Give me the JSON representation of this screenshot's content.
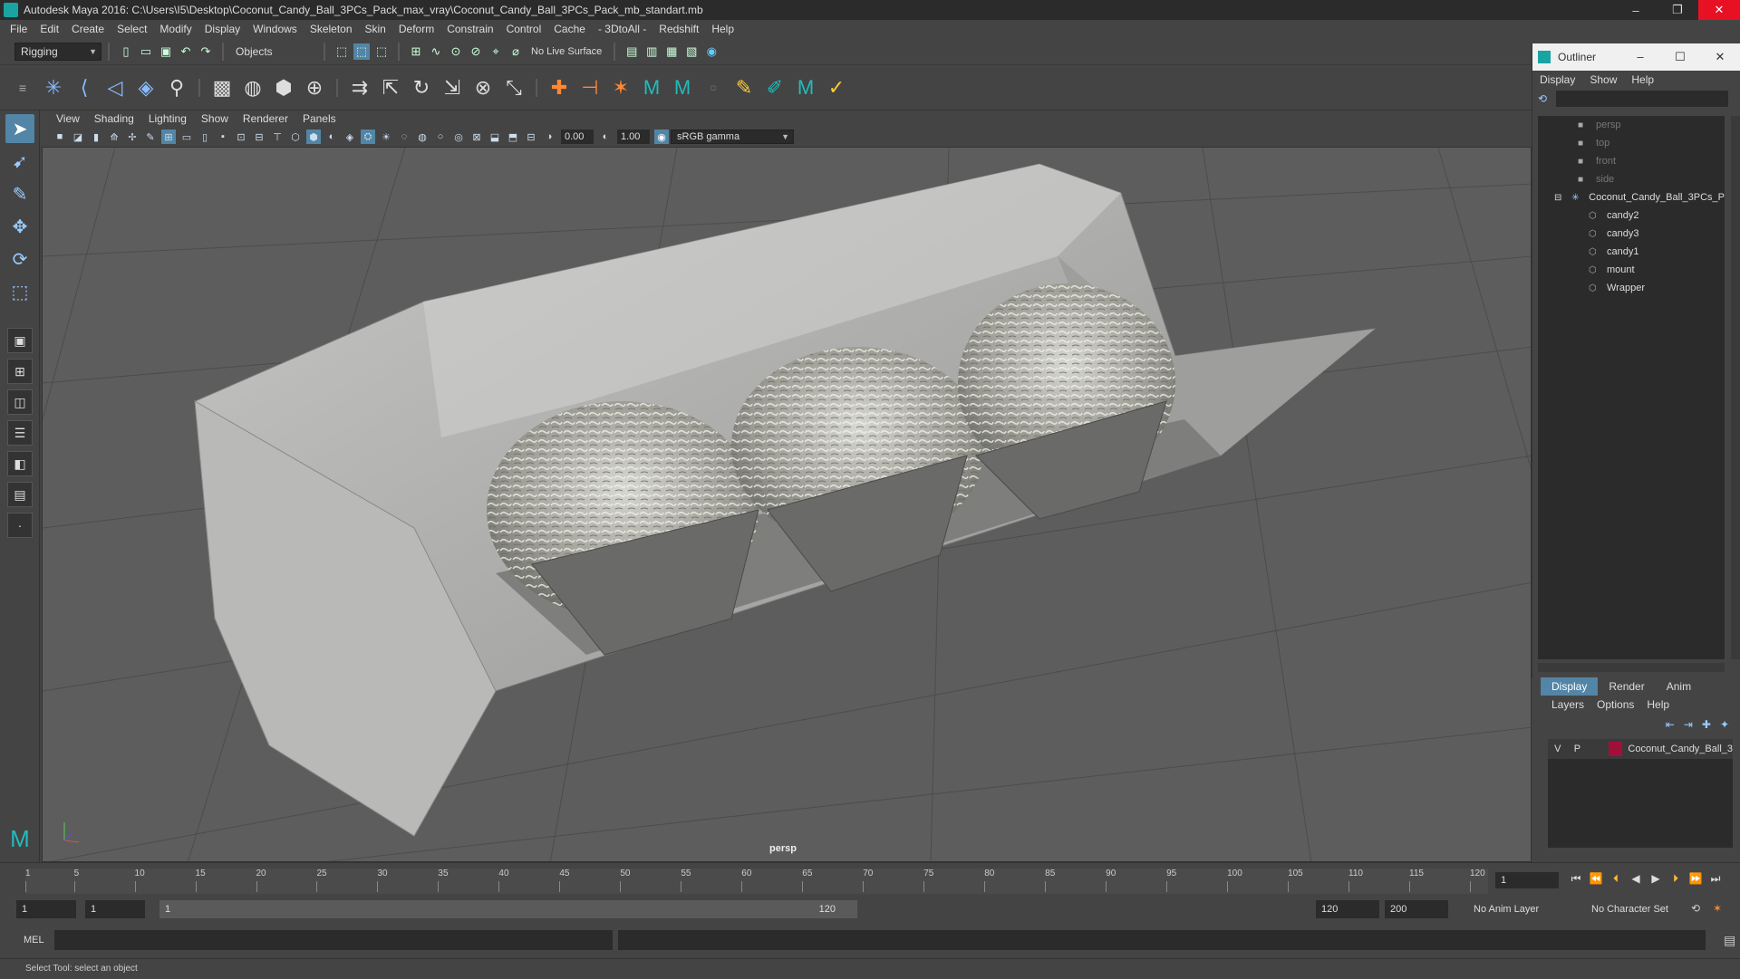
{
  "window": {
    "title": "Autodesk Maya 2016: C:\\Users\\I5\\Desktop\\Coconut_Candy_Ball_3PCs_Pack_max_vray\\Coconut_Candy_Ball_3PCs_Pack_mb_standart.mb",
    "minimize": "–",
    "restore": "❐",
    "close": "✕"
  },
  "menus": [
    "File",
    "Edit",
    "Create",
    "Select",
    "Modify",
    "Display",
    "Windows",
    "Skeleton",
    "Skin",
    "Deform",
    "Constrain",
    "Control",
    "Cache",
    "- 3DtoAll -",
    "Redshift",
    "Help"
  ],
  "status_line": {
    "menuset": "Rigging",
    "select_mode": "Objects",
    "live_surface": "No Live Surface"
  },
  "panel": {
    "menus": [
      "View",
      "Shading",
      "Lighting",
      "Show",
      "Renderer",
      "Panels"
    ],
    "exposure": "0.00",
    "gamma": "1.00",
    "color_space": "sRGB gamma",
    "camera_label": "persp"
  },
  "outliner": {
    "title": "Outliner",
    "menus": [
      "Display",
      "Show",
      "Help"
    ],
    "cameras": [
      "persp",
      "top",
      "front",
      "side"
    ],
    "group": "Coconut_Candy_Ball_3PCs_P",
    "children": [
      "candy2",
      "candy3",
      "candy1",
      "mount",
      "Wrapper"
    ]
  },
  "layer_editor": {
    "tabs": [
      "Display",
      "Render",
      "Anim"
    ],
    "menus": [
      "Layers",
      "Options",
      "Help"
    ],
    "layer": {
      "visible": "V",
      "playback": "P",
      "name": "Coconut_Candy_Ball_3",
      "color": "#a0113a"
    }
  },
  "timeline": {
    "ticks": [
      1,
      5,
      10,
      15,
      20,
      25,
      30,
      35,
      40,
      45,
      50,
      55,
      60,
      65,
      70,
      75,
      80,
      85,
      90,
      95,
      100,
      105,
      110,
      115,
      120
    ],
    "current_frame": "1"
  },
  "range": {
    "start": "1",
    "playback_start": "1",
    "bar_start": "1",
    "bar_end": "120",
    "playback_end": "120",
    "end": "200",
    "anim_layer": "No Anim Layer",
    "character_set": "No Character Set"
  },
  "command_line": {
    "lang": "MEL"
  },
  "help_line": "Select Tool: select an object"
}
